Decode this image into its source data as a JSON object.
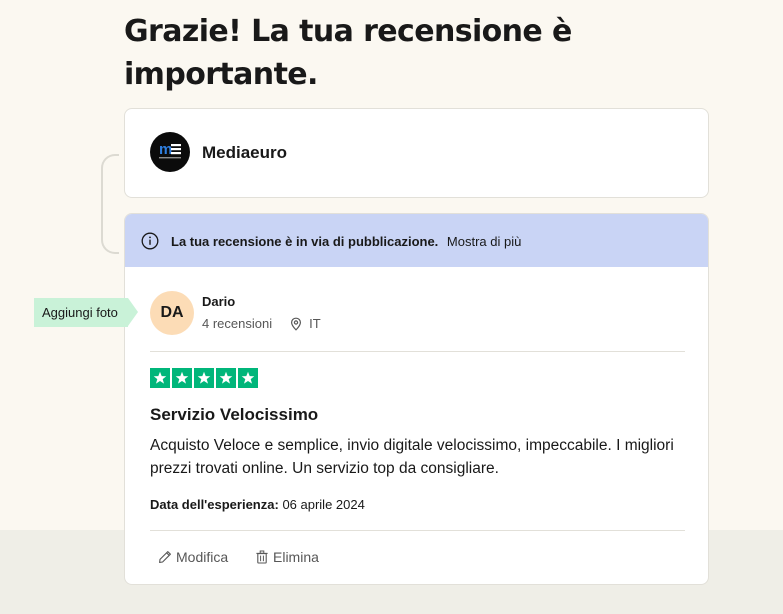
{
  "page": {
    "title": "Grazie! La tua recensione è importante."
  },
  "company": {
    "name": "Mediaeuro",
    "logo_icon": "mediaeuro-logo-icon"
  },
  "notice": {
    "icon": "info-icon",
    "text": "La tua recensione è in via di pubblicazione.",
    "more_label": "Mostra di più",
    "background": "#c9d4f5"
  },
  "tooltip": {
    "label": "Aggiungi foto",
    "background": "#c9f2d8"
  },
  "reviewer": {
    "initials": "DA",
    "name": "Dario",
    "reviews_count": "4 recensioni",
    "location_icon": "location-pin-icon",
    "country": "IT",
    "avatar_color": "#fcdcb6"
  },
  "review": {
    "rating": 5,
    "rating_max": 5,
    "star_color": "#00b67a",
    "title": "Servizio Velocissimo",
    "body": "Acquisto Veloce e semplice, invio digitale velocissimo, impeccabile. I migliori prezzi trovati online. Un servizio top da consigliare.",
    "experience_label": "Data dell'esperienza:",
    "experience_date": "06 aprile 2024"
  },
  "actions": {
    "edit_label": "Modifica",
    "edit_icon": "pencil-icon",
    "delete_label": "Elimina",
    "delete_icon": "trash-icon"
  }
}
